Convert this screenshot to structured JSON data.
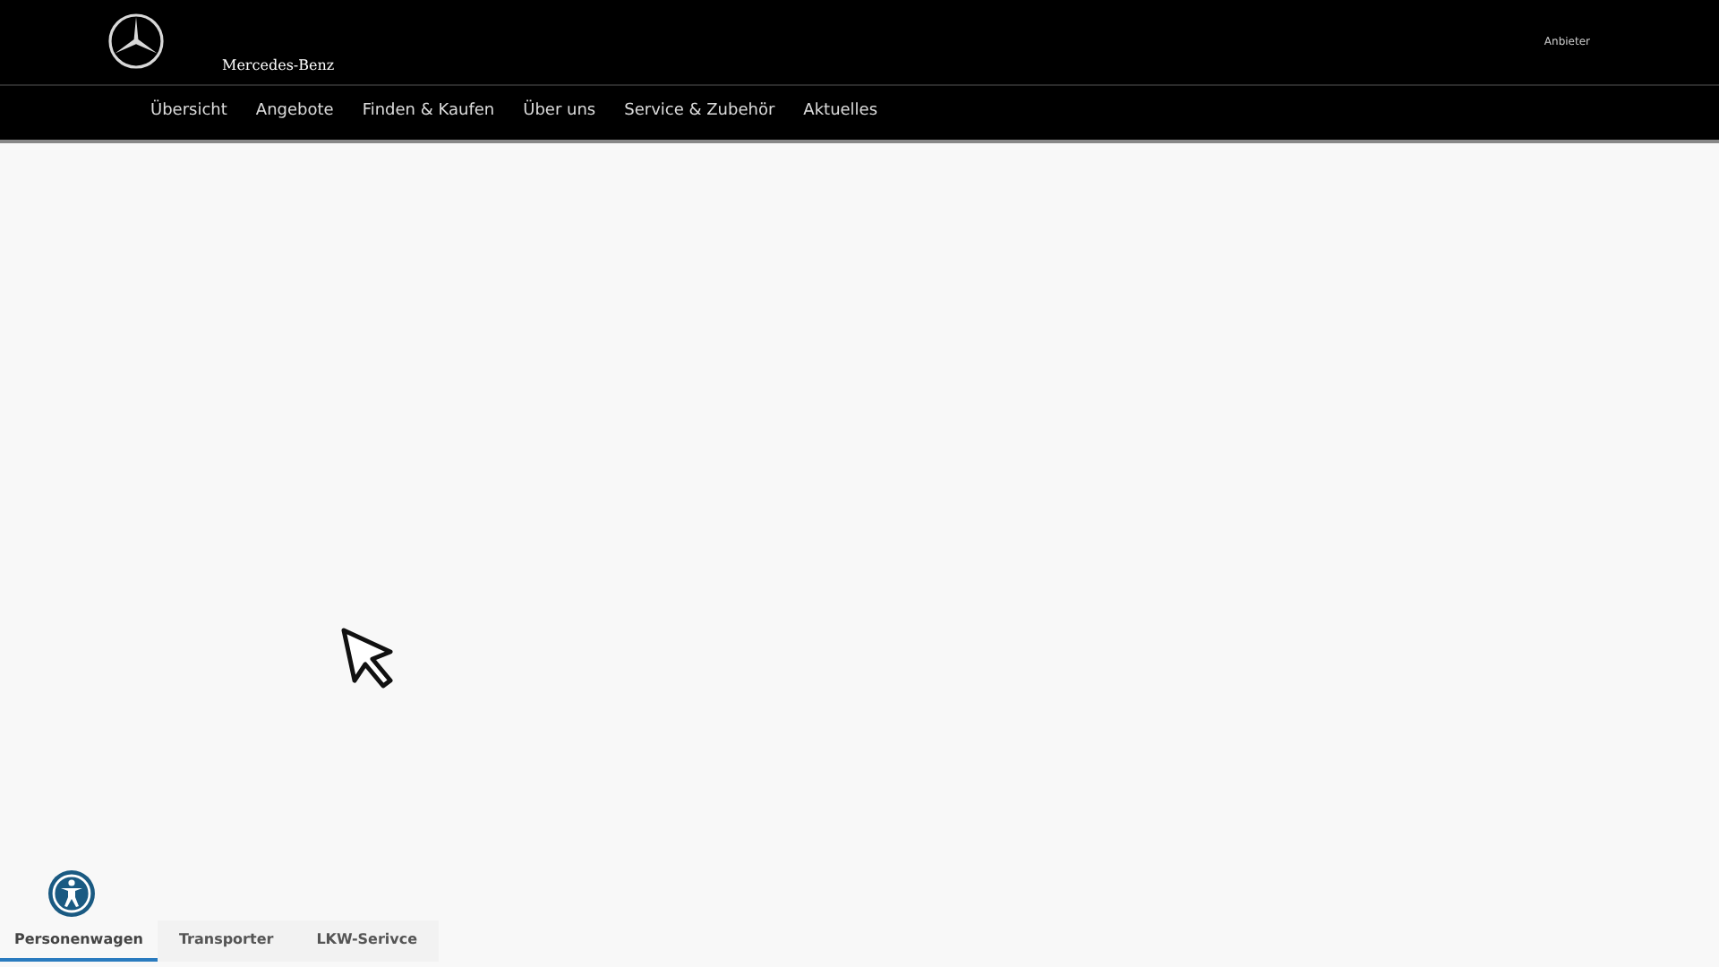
{
  "header": {
    "brand": "Mercedes-Benz",
    "provider_link": "Anbieter"
  },
  "nav": [
    {
      "label": "Übersicht"
    },
    {
      "label": "Angebote"
    },
    {
      "label": "Finden & Kaufen"
    },
    {
      "label": "Über uns"
    },
    {
      "label": "Service & Zubehör"
    },
    {
      "label": "Aktuelles"
    }
  ],
  "bottom_tabs": [
    {
      "label": "Personenwagen",
      "selected": true
    },
    {
      "label": "Transporter",
      "selected": false
    },
    {
      "label": "LKW-Serivce",
      "selected": false
    }
  ]
}
